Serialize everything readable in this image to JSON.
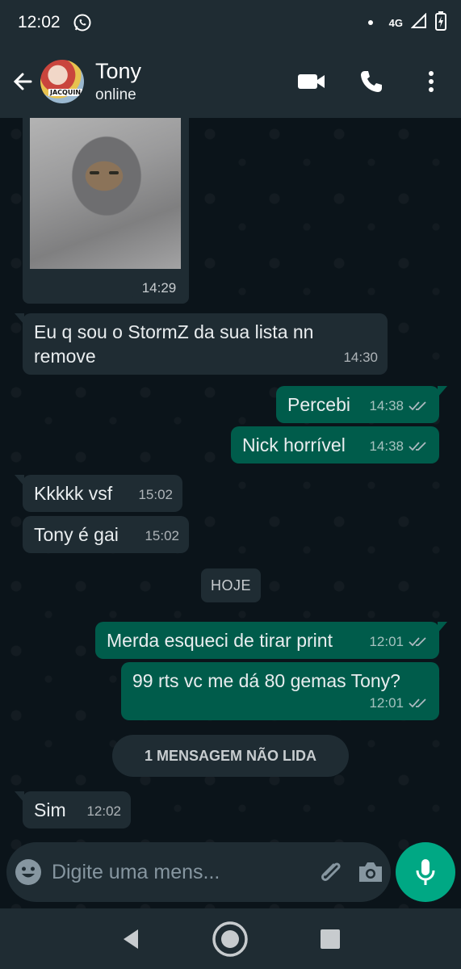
{
  "status_bar": {
    "time": "12:02",
    "network": "4G"
  },
  "header": {
    "contact_name": "Tony",
    "contact_status": "online",
    "avatar_text": "JACQUIN"
  },
  "chat": {
    "image_message": {
      "time": "14:29"
    },
    "messages": [
      {
        "direction": "in",
        "text": "Eu q sou o StormZ da sua lista nn remove",
        "time": "14:30"
      },
      {
        "direction": "out",
        "text": "Percebi",
        "time": "14:38",
        "read": true
      },
      {
        "direction": "out",
        "text": "Nick horrível",
        "time": "14:38",
        "read": true
      },
      {
        "direction": "in",
        "text": "Kkkkk vsf",
        "time": "15:02"
      },
      {
        "direction": "in",
        "text": "Tony é gai",
        "time": "15:02"
      },
      {
        "direction": "out",
        "text": "Merda esqueci de tirar print",
        "time": "12:01",
        "read": true
      },
      {
        "direction": "out",
        "text": "99 rts vc me dá 80 gemas Tony?",
        "time": "12:01",
        "read": true
      },
      {
        "direction": "in",
        "text": "Sim",
        "time": "12:02"
      }
    ],
    "date_divider": "HOJE",
    "unread_divider": "1 MENSAGEM NÃO LIDA"
  },
  "composer": {
    "placeholder": "Digite uma mens..."
  },
  "colors": {
    "header_bg": "#1f2c33",
    "incoming_bubble": "#1f2c33",
    "outgoing_bubble": "#005c4b",
    "accent": "#00a884",
    "chat_bg": "#0b141a"
  }
}
